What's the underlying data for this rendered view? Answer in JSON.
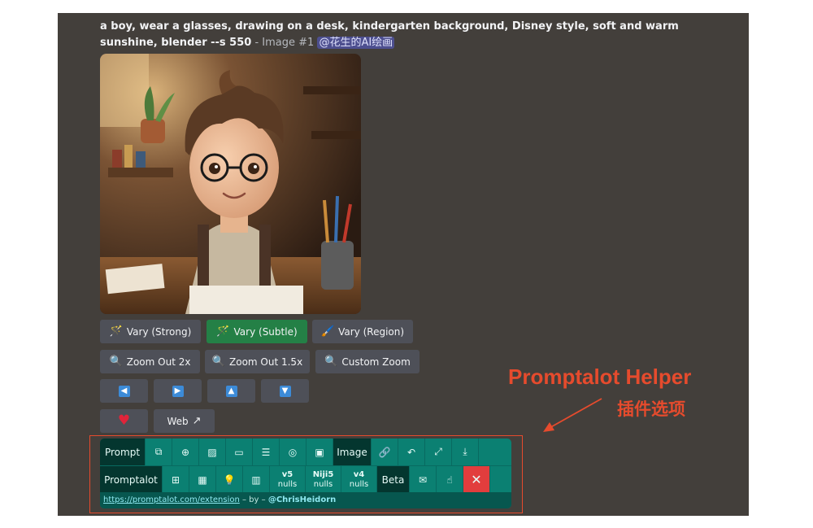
{
  "message": {
    "prompt_text": "a boy, wear a glasses, drawing on a desk, kindergarten background, Disney style, soft and warm sunshine, blender --s 550",
    "image_index": "- Image #1",
    "mention": "@花生的AI绘画"
  },
  "buttons": {
    "vary_strong": "Vary (Strong)",
    "vary_subtle": "Vary (Subtle)",
    "vary_region": "Vary (Region)",
    "zoom_out_2x": "Zoom Out 2x",
    "zoom_out_1_5x": "Zoom Out 1.5x",
    "custom_zoom": "Custom Zoom",
    "web": "Web"
  },
  "annotation": {
    "title": "Promptalot Helper",
    "subtitle": "插件选项"
  },
  "toolbar": {
    "row1": {
      "prompt": "Prompt",
      "image": "Image"
    },
    "row2": {
      "promptalot": "Promptalot",
      "v5": "v5",
      "v5_sub": "nulls",
      "niji5": "Niji5",
      "niji5_sub": "nulls",
      "v4": "v4",
      "v4_sub": "nulls",
      "beta": "Beta"
    },
    "footer": {
      "link": "https://promptalot.com/extension",
      "by": "– by –",
      "author": "@ChrisHeidorn"
    }
  },
  "colors": {
    "background": "#433f3b",
    "button_gray": "#4e5058",
    "button_green": "#248046",
    "toolbar_teal": "#0b8072",
    "annotation_red": "#e64b2d",
    "close_red": "#e23d3d"
  }
}
